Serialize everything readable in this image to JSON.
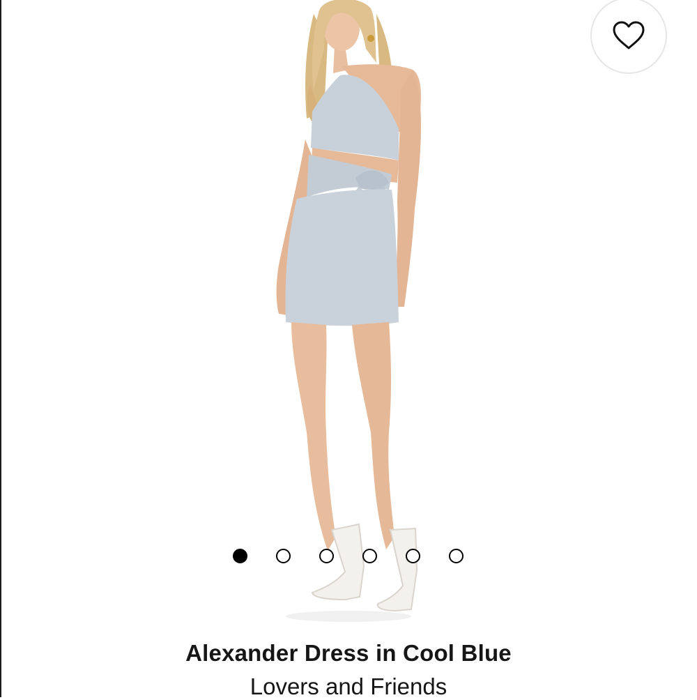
{
  "product": {
    "title": "Alexander Dress in Cool Blue",
    "brand": "Lovers and Friends",
    "image": "model-wearing-one-shoulder-cutout-dress-icon",
    "dress_color": "#c6d0d8"
  },
  "favorite": {
    "icon": "heart-outline-icon"
  },
  "carousel": {
    "total": 6,
    "active_index": 0
  }
}
